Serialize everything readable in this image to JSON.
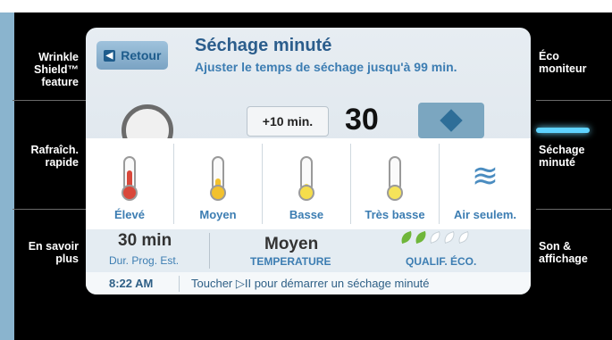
{
  "left_menu": [
    {
      "label_lines": [
        "Wrinkle",
        "Shield™",
        "feature"
      ]
    },
    {
      "label_lines": [
        "Rafraîch.",
        "rapide"
      ]
    },
    {
      "label_lines": [
        "En savoir",
        "plus"
      ]
    }
  ],
  "right_menu": [
    {
      "label_lines": [
        "Éco",
        "moniteur"
      ]
    },
    {
      "label_lines": [
        "Séchage",
        "minuté"
      ],
      "selected": true
    },
    {
      "label_lines": [
        "Son &",
        "affichage"
      ]
    }
  ],
  "header": {
    "back_label": "Retour",
    "title": "Séchage minuté",
    "subtitle": "Ajuster le temps de séchage jusqu'à 99 min."
  },
  "time_control": {
    "increment_label": "+10 min.",
    "value_partial": "30"
  },
  "temperatures": [
    {
      "label": "Élevé",
      "fill_color": "#d9473a",
      "level": 0.6,
      "icon": "thermometer-icon"
    },
    {
      "label": "Moyen",
      "fill_color": "#f2c12e",
      "level": 0.35,
      "icon": "thermometer-icon"
    },
    {
      "label": "Basse",
      "fill_color": "#f5dd4b",
      "level": 0.2,
      "icon": "thermometer-icon"
    },
    {
      "label": "Très basse",
      "fill_color": "#f5e35a",
      "level": 0.1,
      "icon": "thermometer-icon"
    },
    {
      "label": "Air seulem.",
      "icon": "wind-icon"
    }
  ],
  "summary": {
    "duration_value": "30 min",
    "duration_label": "Dur. Prog. Est.",
    "temperature_value": "Moyen",
    "temperature_label": "TEMPERATURE",
    "eco_label": "QUALIF. ÉCO.",
    "eco_rating": 2,
    "eco_max": 5
  },
  "status": {
    "time": "8:22 AM",
    "hint": "Toucher ▷II pour démarrer un séchage minuté"
  },
  "colors": {
    "accent": "#3c7db2",
    "selection_glow": "#5fd3ff",
    "eco_leaf_on": "#6fb63a"
  }
}
